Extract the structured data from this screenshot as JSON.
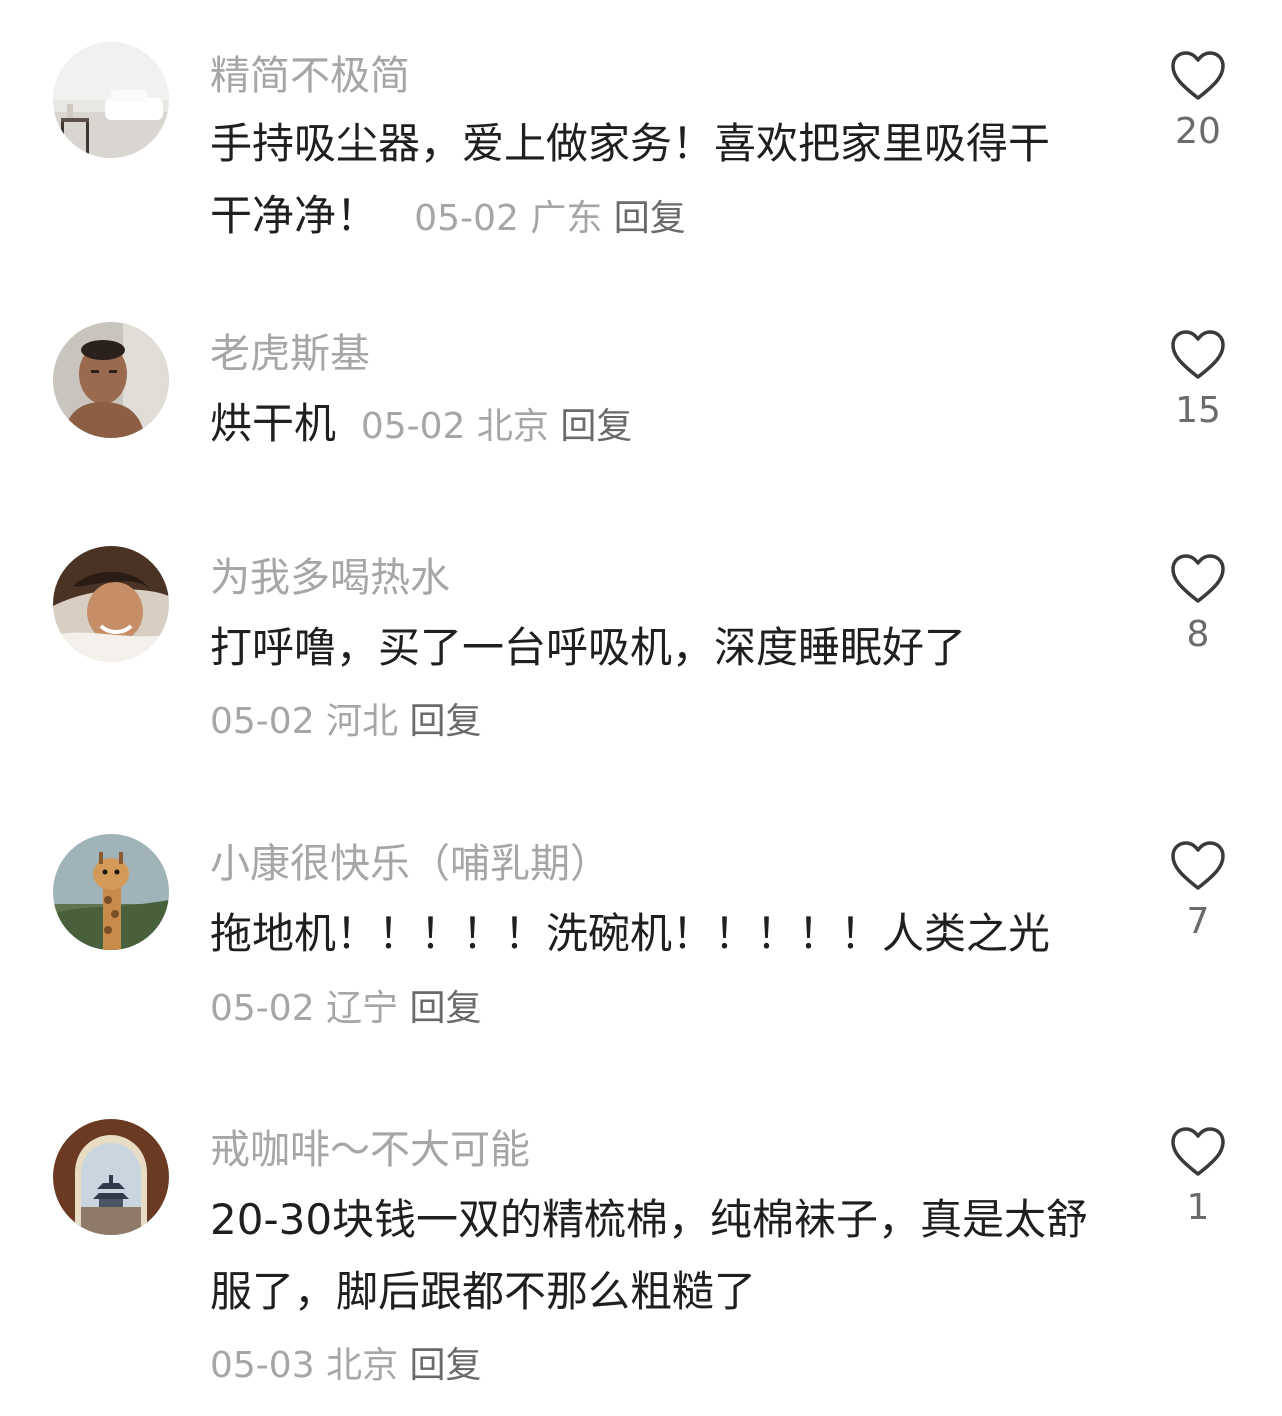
{
  "comments": [
    {
      "username": "精简不极简",
      "text": "手持吸尘器，爱上做家务！喜欢把家里吸得干干净净！",
      "date": "05-02",
      "location": "广东",
      "reply": "回复",
      "likes": "20",
      "avatar_icon": "bedroom-photo-avatar"
    },
    {
      "username": "老虎斯基",
      "text": "烘干机",
      "date": "05-02",
      "location": "北京",
      "reply": "回复",
      "likes": "15",
      "avatar_icon": "man-portrait-avatar"
    },
    {
      "username": "为我多喝热水",
      "text": "打呼噜，买了一台呼吸机，深度睡眠好了",
      "date": "05-02",
      "location": "河北",
      "reply": "回复",
      "likes": "8",
      "avatar_icon": "smiling-person-avatar"
    },
    {
      "username": "小康很快乐（哺乳期）",
      "text": "拖地机！！！！！洗碗机！！！！！人类之光",
      "date": "05-02",
      "location": "辽宁",
      "reply": "回复",
      "likes": "7",
      "avatar_icon": "giraffe-avatar"
    },
    {
      "username": "戒咖啡～不大可能",
      "text": "20-30块钱一双的精梳棉，纯棉袜子，真是太舒服了，脚后跟都不那么粗糙了",
      "date": "05-03",
      "location": "北京",
      "reply": "回复",
      "likes": "1",
      "avatar_icon": "temple-arch-avatar"
    }
  ],
  "colors": {
    "username": "#a6a6a6",
    "text": "#1f1f1f",
    "meta": "#a6a6a6",
    "reply": "#6a6a6a",
    "like_count": "#6b6b6b",
    "heart_outline": "#3a3a3a"
  },
  "icons": {
    "like": "heart-outline-icon"
  }
}
